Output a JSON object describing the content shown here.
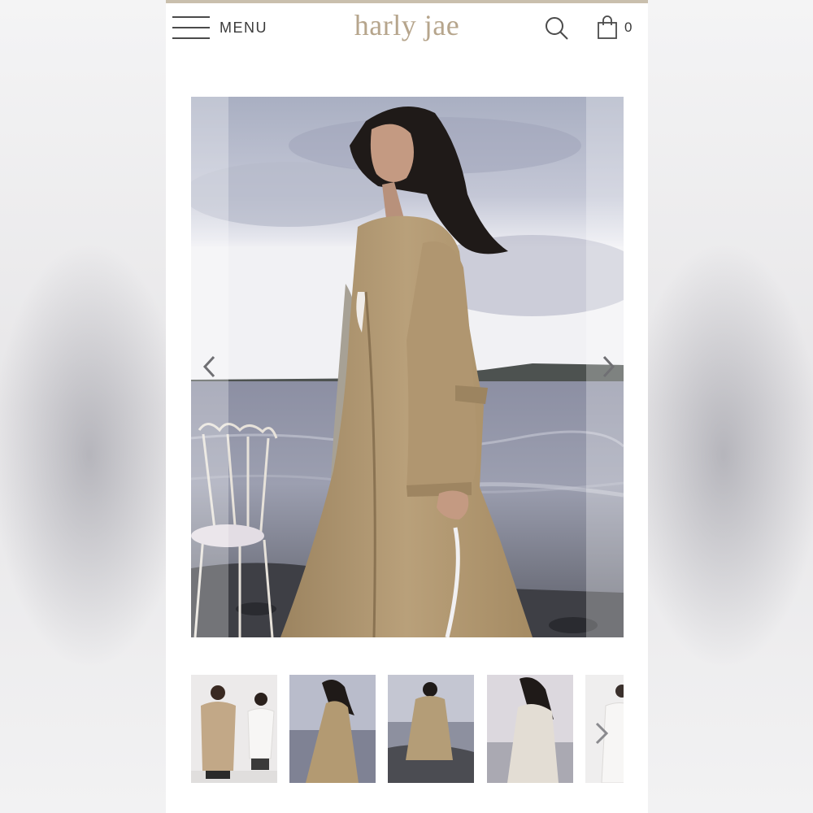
{
  "header": {
    "menu_label": "MENU",
    "logo_text": "harly jae",
    "cart_count": "0",
    "icons": {
      "menu": "hamburger-icon",
      "search": "search-icon",
      "cart": "shopping-bag-icon"
    }
  },
  "gallery": {
    "prev_icon": "chevron-left-icon",
    "next_icon": "chevron-right-icon",
    "thumbnail_count": 5
  },
  "colors": {
    "brand": "#b6a58c",
    "top_bar": "#c9bfad",
    "coat": "#b39a72",
    "text": "#3a3a3a"
  }
}
